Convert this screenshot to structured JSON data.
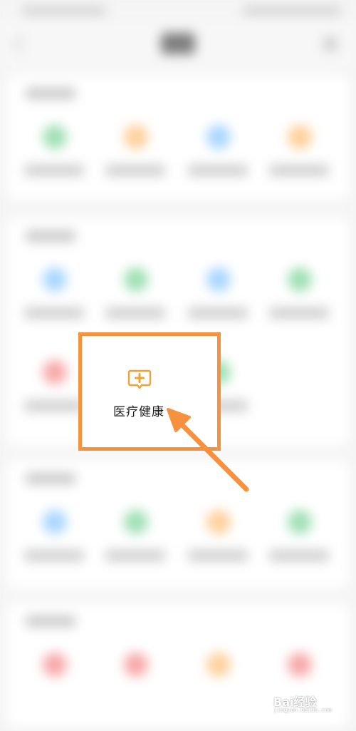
{
  "highlighted_item": {
    "label": "医疗健康",
    "icon": "medical-plus-chat-icon",
    "accent": "#f0a233"
  },
  "annotation": {
    "box_color": "#f7913d",
    "arrow_color": "#f7913d"
  },
  "background_icon_colors": {
    "green": "#9fe0b5",
    "orange": "#ffd09a",
    "blue": "#a9d6ff",
    "red": "#f7a8a8"
  },
  "watermark": {
    "main": "Bai经验",
    "sub": "jingyan.baidu.com"
  }
}
